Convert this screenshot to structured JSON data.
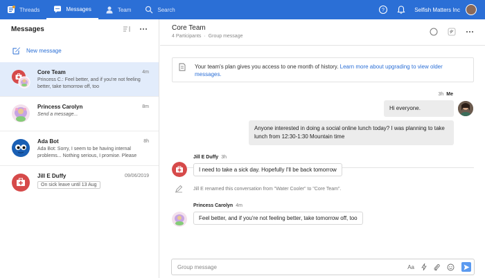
{
  "topbar": {
    "nav": [
      {
        "label": "Threads",
        "icon": "threads-icon"
      },
      {
        "label": "Messages",
        "icon": "messages-icon"
      },
      {
        "label": "Team",
        "icon": "team-icon"
      },
      {
        "label": "Search",
        "icon": "search-icon"
      }
    ],
    "active_nav": "Messages",
    "org_name": "Selfish Matters Inc",
    "accent_color": "#2b6fd6"
  },
  "left": {
    "title": "Messages",
    "new_message_label": "New message",
    "threads": [
      {
        "name": "Core Team",
        "time": "4m",
        "preview": "Princess C.: Feel better, and if you're not feeling better, take tomorrow off, too",
        "selected": true
      },
      {
        "name": "Princess Carolyn",
        "time": "8m",
        "preview": "Send a message..."
      },
      {
        "name": "Ada Bot",
        "time": "8h",
        "preview": "Ada Bot: Sorry, I seem to be having internal problems... Nothing serious, I promise. Please"
      },
      {
        "name": "Jill E Duffy",
        "time": "09/06/2019",
        "tag": "On sick leave until 13 Aug"
      }
    ]
  },
  "conversation": {
    "title": "Core Team",
    "participants": "4 Participants",
    "type": "Group message",
    "history_banner": {
      "text": "Your team's plan gives you access to one month of history.",
      "link": "Learn more about upgrading to view older messages."
    },
    "me_meta": {
      "time": "3h",
      "name": "Me"
    },
    "me_messages": [
      "Hi everyone.",
      "Anyone interested in doing a social online lunch today? I was planning to take lunch from 12:30-1:30 Mountain time"
    ],
    "jill": {
      "name": "Jill E Duffy",
      "time": "3h",
      "message": "I need to take a sick day. Hopefully I'll be back tomorrow"
    },
    "system_message": "Jill E renamed this conversation from \"Water Cooler\" to \"Core Team\".",
    "princess": {
      "name": "Princess Carolyn",
      "time": "4m",
      "message": "Feel better, and if you're not feeling better, take tomorrow off, too"
    },
    "composer": {
      "placeholder": "Group message",
      "format_label": "Aa"
    }
  }
}
